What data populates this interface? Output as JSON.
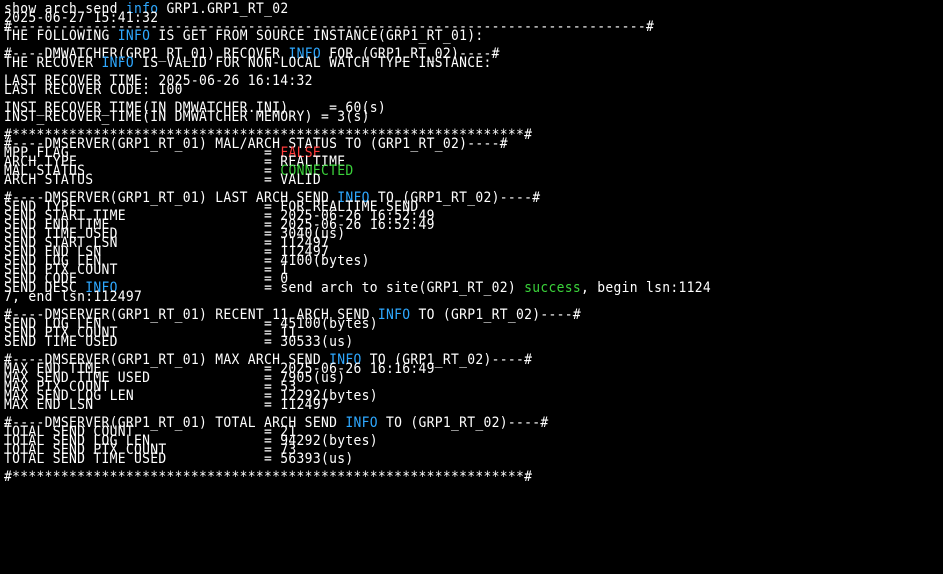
{
  "terminal": {
    "lines": [
      [
        {
          "t": "show arch send "
        },
        {
          "t": "info",
          "c": "b"
        },
        {
          "t": " GRP1.GRP1_RT_02"
        }
      ],
      [
        {
          "t": "2025-06-27 15:41:32"
        }
      ],
      [
        {
          "t": "#------------------------------------------------------------------------------#"
        }
      ],
      [
        {
          "t": "THE FOLLOWING "
        },
        {
          "t": "INFO",
          "c": "b"
        },
        {
          "t": " IS GET FROM SOURCE INSTANCE(GRP1_RT_01):"
        }
      ],
      [],
      [
        {
          "t": "#----DMWATCHER(GRP1_RT_01) RECOVER "
        },
        {
          "t": "INFO",
          "c": "b"
        },
        {
          "t": " FOR (GRP1_RT_02)----#"
        }
      ],
      [
        {
          "t": "THE RECOVER "
        },
        {
          "t": "INFO",
          "c": "b"
        },
        {
          "t": " IS VALID FOR NON-LOCAL WATCH TYPE INSTANCE:"
        }
      ],
      [],
      [
        {
          "t": "LAST RECOVER TIME: 2025-06-26 16:14:32"
        }
      ],
      [
        {
          "t": "LAST RECOVER CODE: 100"
        }
      ],
      [],
      [
        {
          "t": "INST_RECOVER_TIME(IN DMWATCHER.INI)     = 60(s)"
        }
      ],
      [
        {
          "t": "INST_RECOVER_TIME(IN DMWATCHER MEMORY) = 3(s)"
        }
      ],
      [],
      [
        {
          "t": "#***************************************************************#"
        }
      ],
      [
        {
          "t": "#----DMSERVER(GRP1_RT_01) MAL/ARCH STATUS TO (GRP1_RT_02)----#"
        }
      ],
      [
        {
          "t": "MPP_FLAG                        = "
        },
        {
          "t": "FALSE",
          "c": "r"
        }
      ],
      [
        {
          "t": "ARCH TYPE                       = REALTIME"
        }
      ],
      [
        {
          "t": "MAL STATUS                      = "
        },
        {
          "t": "CONNECTED",
          "c": "g"
        }
      ],
      [
        {
          "t": "ARCH STATUS                     = VALID"
        }
      ],
      [],
      [
        {
          "t": "#----DMSERVER(GRP1_RT_01) LAST ARCH SEND "
        },
        {
          "t": "INFO",
          "c": "b"
        },
        {
          "t": " TO (GRP1_RT_02)----#"
        }
      ],
      [
        {
          "t": "SEND TYPE                       = FOR REALTIME SEND"
        }
      ],
      [
        {
          "t": "SEND START TIME                 = 2025-06-26 16:52:49"
        }
      ],
      [
        {
          "t": "SEND END TIME                   = 2025-06-26 16:52:49"
        }
      ],
      [
        {
          "t": "SEND TIME USED                  = 3040(us)"
        }
      ],
      [
        {
          "t": "SEND START LSN                  = 112497"
        }
      ],
      [
        {
          "t": "SEND END LSN                    = 112497"
        }
      ],
      [
        {
          "t": "SEND LOG LEN                    = 4100(bytes)"
        }
      ],
      [
        {
          "t": "SEND PTX COUNT                  = 1"
        }
      ],
      [
        {
          "t": "SEND CODE                       = 0"
        }
      ],
      [
        {
          "t": "SEND DESC "
        },
        {
          "t": "INFO",
          "c": "b"
        },
        {
          "t": "                  = send arch to site(GRP1_RT_02) "
        },
        {
          "t": "success",
          "c": "g"
        },
        {
          "t": ", begin lsn:1124"
        }
      ],
      [
        {
          "t": "7, end lsn:112497"
        }
      ],
      [],
      [
        {
          "t": "#----DMSERVER(GRP1_RT_01) RECENT 11 ARCH SEND "
        },
        {
          "t": "INFO",
          "c": "b"
        },
        {
          "t": " TO (GRP1_RT_02)----#"
        }
      ],
      [
        {
          "t": "SEND LOG LEN                    = 45100(bytes)"
        }
      ],
      [
        {
          "t": "SEND PTX COUNT                  = 11"
        }
      ],
      [
        {
          "t": "SEND TIME USED                  = 30533(us)"
        }
      ],
      [],
      [
        {
          "t": "#----DMSERVER(GRP1_RT_01) MAX ARCH SEND "
        },
        {
          "t": "INFO",
          "c": "b"
        },
        {
          "t": " TO (GRP1_RT_02)----#"
        }
      ],
      [
        {
          "t": "MAX END TIME                    = 2025-06-26 16:16:49"
        }
      ],
      [
        {
          "t": "MAX SEND TIME USED              = 7905(us)"
        }
      ],
      [
        {
          "t": "MAX PTX COUNT                   = 53"
        }
      ],
      [
        {
          "t": "MAX SEND LOG LEN                = 12292(bytes)"
        }
      ],
      [
        {
          "t": "MAX END LSN                     = 112497"
        }
      ],
      [],
      [
        {
          "t": "#----DMSERVER(GRP1_RT_01) TOTAL ARCH SEND "
        },
        {
          "t": "INFO",
          "c": "b"
        },
        {
          "t": " TO (GRP1_RT_02)----#"
        }
      ],
      [
        {
          "t": "TOTAL SEND COUNT                = 21"
        }
      ],
      [
        {
          "t": "TOTAL SEND LOG LEN              = 94292(bytes)"
        }
      ],
      [
        {
          "t": "TOTAL SEND PTX COUNT            = 73"
        }
      ],
      [
        {
          "t": "TOTAL SEND TIME USED            = 56393(us)"
        }
      ],
      [],
      [
        {
          "t": "#***************************************************************#"
        }
      ]
    ]
  },
  "colors": {
    "background": "#000000",
    "text": "#ffffff",
    "info_keyword": "#2ea8ff",
    "false_value": "#ff3b3b",
    "ok_value": "#3ad13a"
  }
}
